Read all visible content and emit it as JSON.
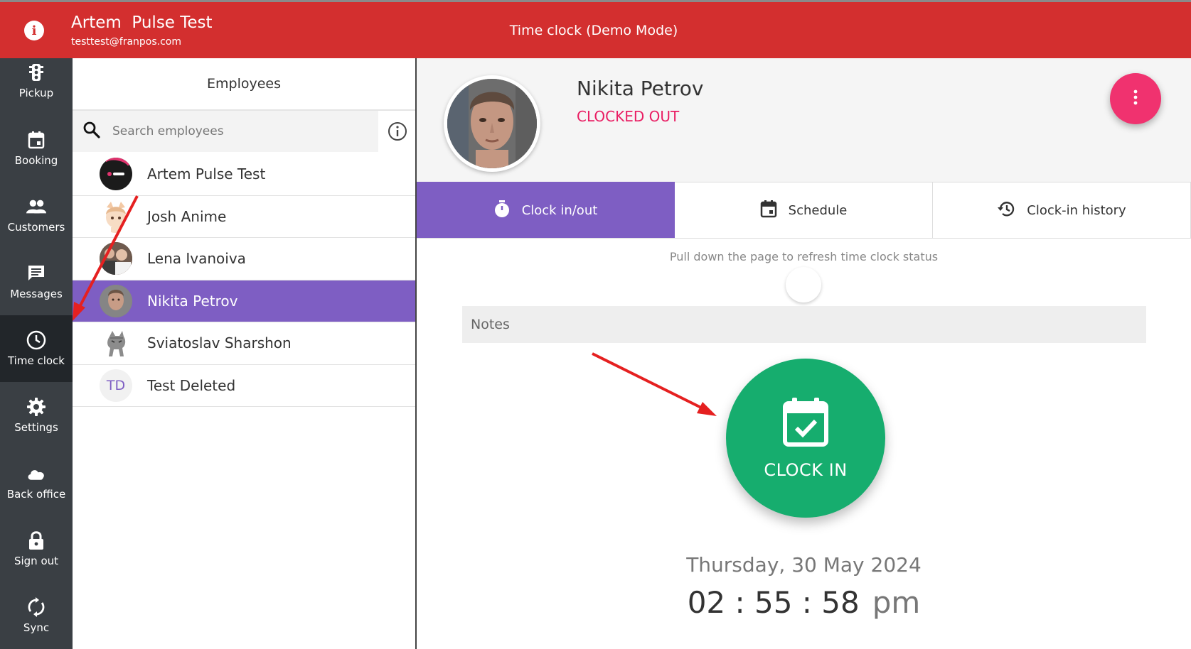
{
  "header": {
    "user_name": "Artem  Pulse Test",
    "user_email": "testtest@franpos.com",
    "title": "Time clock (Demo Mode)"
  },
  "sidebar": {
    "items": [
      {
        "label": "Pickup",
        "icon": "traffic-light-icon"
      },
      {
        "label": "Booking",
        "icon": "calendar-icon"
      },
      {
        "label": "Customers",
        "icon": "people-icon"
      },
      {
        "label": "Messages",
        "icon": "chat-icon"
      },
      {
        "label": "Time clock",
        "icon": "clock-icon",
        "active": true
      },
      {
        "label": "Settings",
        "icon": "gear-icon"
      },
      {
        "label": "Back office",
        "icon": "cloud-icon"
      },
      {
        "label": "Sign out",
        "icon": "lock-icon"
      },
      {
        "label": "Sync",
        "icon": "sync-icon"
      }
    ]
  },
  "employees": {
    "header": "Employees",
    "search_placeholder": "Search employees",
    "list": [
      {
        "name": "Artem Pulse Test",
        "avatar": "franpos-logo"
      },
      {
        "name": "Josh Anime",
        "avatar": "anime-avatar"
      },
      {
        "name": "Lena Ivanoiva",
        "avatar": "group-photo"
      },
      {
        "name": "Nikita Petrov",
        "avatar": "portrait-photo",
        "selected": true
      },
      {
        "name": "Sviatoslav Sharshon",
        "avatar": "cat-photo"
      },
      {
        "name": "Test Deleted",
        "avatar_initials": "TD"
      }
    ]
  },
  "detail": {
    "name": "Nikita Petrov",
    "status": "CLOCKED OUT",
    "tabs": [
      {
        "label": "Clock in/out",
        "icon": "stopwatch-icon",
        "active": true
      },
      {
        "label": "Schedule",
        "icon": "calendar-icon"
      },
      {
        "label": "Clock-in history",
        "icon": "history-icon"
      }
    ],
    "refresh_hint": "Pull down the page to refresh time clock status",
    "notes_placeholder": "Notes",
    "clock_button_label": "CLOCK IN",
    "date": "Thursday, 30 May 2024",
    "time": "02 : 55 : 58",
    "ampm": "pm"
  },
  "colors": {
    "header_red": "#d32f2f",
    "accent_purple": "#7e5ec3",
    "clock_in_green": "#16ad6e",
    "status_pink": "#e91e63",
    "fab_pink": "#f0326f",
    "sidebar_dark": "#3a3f44"
  }
}
